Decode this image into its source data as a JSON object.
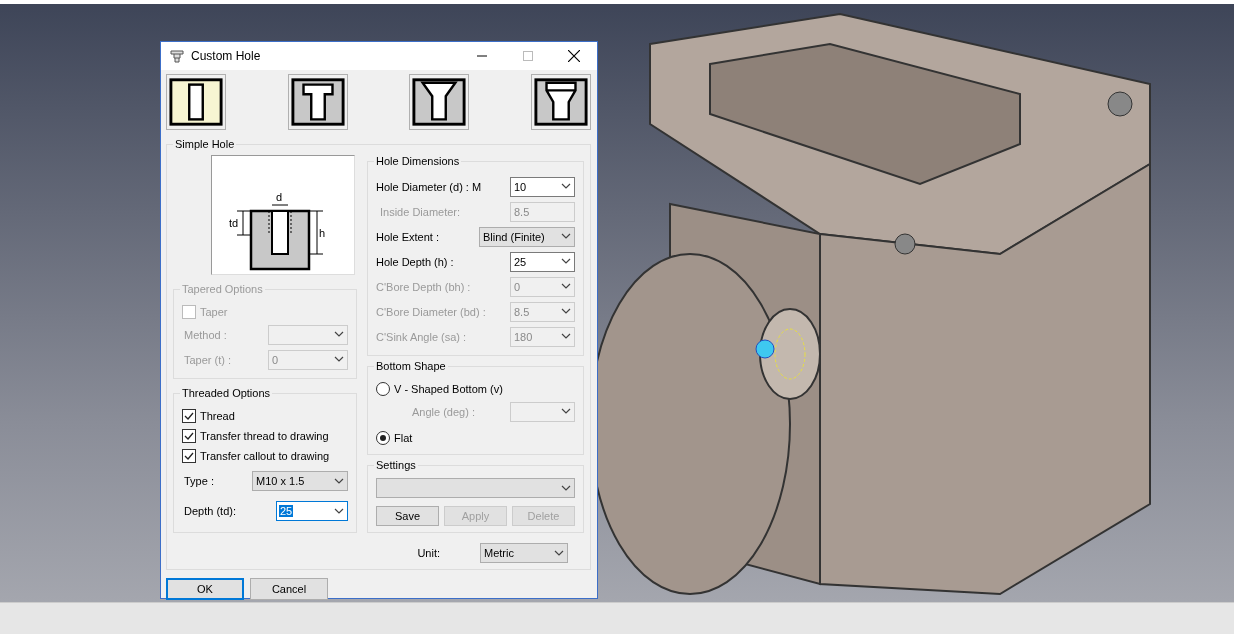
{
  "window": {
    "title": "Custom Hole"
  },
  "hole_types": [
    {
      "kind": "simple",
      "selected": true
    },
    {
      "kind": "counterbore",
      "selected": false
    },
    {
      "kind": "countersink",
      "selected": false
    },
    {
      "kind": "counterdrill",
      "selected": false
    }
  ],
  "simple_hole": {
    "title": "Simple Hole",
    "diagram_labels": {
      "diameter": "d",
      "thread_depth": "td",
      "depth": "h"
    }
  },
  "tapered_options": {
    "title": "Tapered Options",
    "disabled": true,
    "taper": {
      "label": "Taper",
      "checked": false
    },
    "fields": [
      {
        "label": "Method :"
      },
      {
        "label": "Taper (t) :",
        "value": "0"
      }
    ]
  },
  "threaded_options": {
    "title": "Threaded Options",
    "checkboxes": [
      {
        "label": "Thread",
        "checked": true
      },
      {
        "label": "Transfer thread to drawing",
        "checked": true
      },
      {
        "label": "Transfer callout to drawing",
        "checked": true
      }
    ],
    "fields": [
      {
        "label": "Type :",
        "value": "M10 x 1.5",
        "kind": "list",
        "focused": false
      },
      {
        "label": "Depth (td):",
        "value": "25",
        "kind": "combo",
        "focused": true
      }
    ]
  },
  "hole_dimensions": {
    "title": "Hole Dimensions",
    "fields": [
      {
        "label": "Hole Diameter (d) : M",
        "value": "10",
        "kind": "combo",
        "disabled": false
      },
      {
        "label": "Inside Diameter:",
        "value": "8.5",
        "kind": "text",
        "disabled": true
      },
      {
        "label": "Hole Extent :",
        "value": "Blind (Finite)",
        "kind": "list",
        "disabled": false
      },
      {
        "label": "Hole Depth (h) :",
        "value": "25",
        "kind": "combo",
        "disabled": false
      },
      {
        "label": "C'Bore Depth (bh) :",
        "value": "0",
        "kind": "combo",
        "disabled": true
      },
      {
        "label": "C'Bore Diameter (bd) :",
        "value": "8.5",
        "kind": "combo",
        "disabled": true
      },
      {
        "label": "C'Sink Angle (sa) :",
        "value": "180",
        "kind": "combo",
        "disabled": true
      }
    ]
  },
  "bottom_shape": {
    "title": "Bottom Shape",
    "options": [
      {
        "label": "V - Shaped Bottom (v)",
        "selected": false
      },
      {
        "label": "Flat",
        "selected": true
      }
    ],
    "angle": {
      "label": "Angle (deg) :",
      "disabled": true
    }
  },
  "settings": {
    "title": "Settings",
    "buttons": [
      {
        "label": "Save",
        "disabled": false
      },
      {
        "label": "Apply",
        "disabled": true
      },
      {
        "label": "Delete",
        "disabled": true
      }
    ]
  },
  "unit": {
    "label": "Unit:",
    "value": "Metric"
  },
  "buttons": [
    {
      "label": "OK",
      "default": true
    },
    {
      "label": "Cancel",
      "default": false
    }
  ]
}
